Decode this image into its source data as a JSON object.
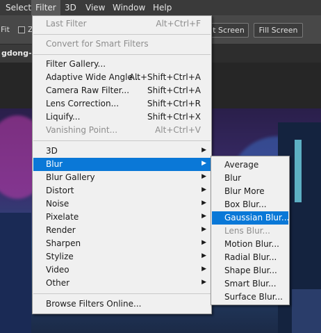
{
  "menubar": {
    "items": [
      "Select",
      "Filter",
      "3D",
      "View",
      "Window",
      "Help"
    ],
    "active": "Filter"
  },
  "options_bar": {
    "fit_label": "Fit",
    "zoom_label": "Z",
    "screen_button": "t Screen",
    "fill_screen_button": "Fill Screen"
  },
  "document": {
    "tab_title": "gdong-ra"
  },
  "filter_menu": {
    "items": [
      {
        "label": "Last Filter",
        "shortcut": "Alt+Ctrl+F",
        "disabled": true
      },
      {
        "label": "Convert for Smart Filters",
        "shortcut": "",
        "disabled": true
      },
      {
        "label": "Filter Gallery...",
        "shortcut": "",
        "disabled": false
      },
      {
        "label": "Adaptive Wide Angle...",
        "shortcut": "Alt+Shift+Ctrl+A",
        "disabled": false
      },
      {
        "label": "Camera Raw Filter...",
        "shortcut": "Shift+Ctrl+A",
        "disabled": false
      },
      {
        "label": "Lens Correction...",
        "shortcut": "Shift+Ctrl+R",
        "disabled": false
      },
      {
        "label": "Liquify...",
        "shortcut": "Shift+Ctrl+X",
        "disabled": false
      },
      {
        "label": "Vanishing Point...",
        "shortcut": "Alt+Ctrl+V",
        "disabled": true
      },
      {
        "label": "3D",
        "submenu": true
      },
      {
        "label": "Blur",
        "submenu": true,
        "highlighted": true
      },
      {
        "label": "Blur Gallery",
        "submenu": true
      },
      {
        "label": "Distort",
        "submenu": true
      },
      {
        "label": "Noise",
        "submenu": true
      },
      {
        "label": "Pixelate",
        "submenu": true
      },
      {
        "label": "Render",
        "submenu": true
      },
      {
        "label": "Sharpen",
        "submenu": true
      },
      {
        "label": "Stylize",
        "submenu": true
      },
      {
        "label": "Video",
        "submenu": true
      },
      {
        "label": "Other",
        "submenu": true
      },
      {
        "label": "Browse Filters Online..."
      }
    ]
  },
  "blur_submenu": {
    "items": [
      {
        "label": "Average"
      },
      {
        "label": "Blur"
      },
      {
        "label": "Blur More"
      },
      {
        "label": "Box Blur..."
      },
      {
        "label": "Gaussian Blur...",
        "highlighted": true
      },
      {
        "label": "Lens Blur...",
        "disabled": true
      },
      {
        "label": "Motion Blur..."
      },
      {
        "label": "Radial Blur..."
      },
      {
        "label": "Shape Blur..."
      },
      {
        "label": "Smart Blur..."
      },
      {
        "label": "Surface Blur..."
      }
    ]
  },
  "colors": {
    "menu_bg": "#f0f0f0",
    "highlight": "#0a78d7",
    "menubar_bg": "#3a3a3a"
  }
}
